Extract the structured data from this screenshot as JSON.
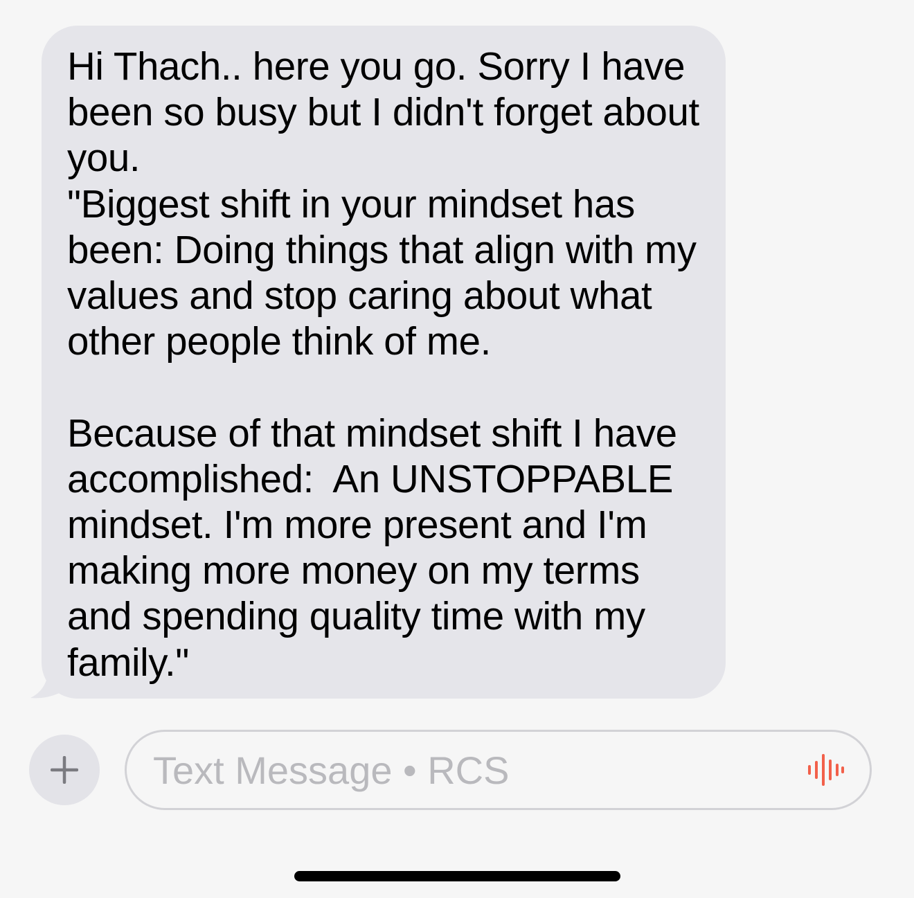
{
  "message": {
    "paragraphs": [
      "Hi Thach.. here you go. Sorry I have been so busy but I didn't forget about you.\n\"Biggest shift in your mindset has been: Doing things that align with my values and stop caring about what other people think of me.",
      "Because of that mindset shift I have accomplished:  An UNSTOPPABLE mindset. I'm more present and I'm making more money on my terms and spending quality time with my family.\""
    ],
    "bubble_color": "#e5e5ea",
    "text_color": "#000000"
  },
  "composer": {
    "add_icon": "plus-icon",
    "input_placeholder": "Text Message • RCS",
    "input_value": "",
    "voice_icon": "waveform-icon",
    "voice_icon_color": "#f2604a"
  },
  "colors": {
    "background": "#f6f6f6",
    "placeholder": "#b9b9bd"
  }
}
